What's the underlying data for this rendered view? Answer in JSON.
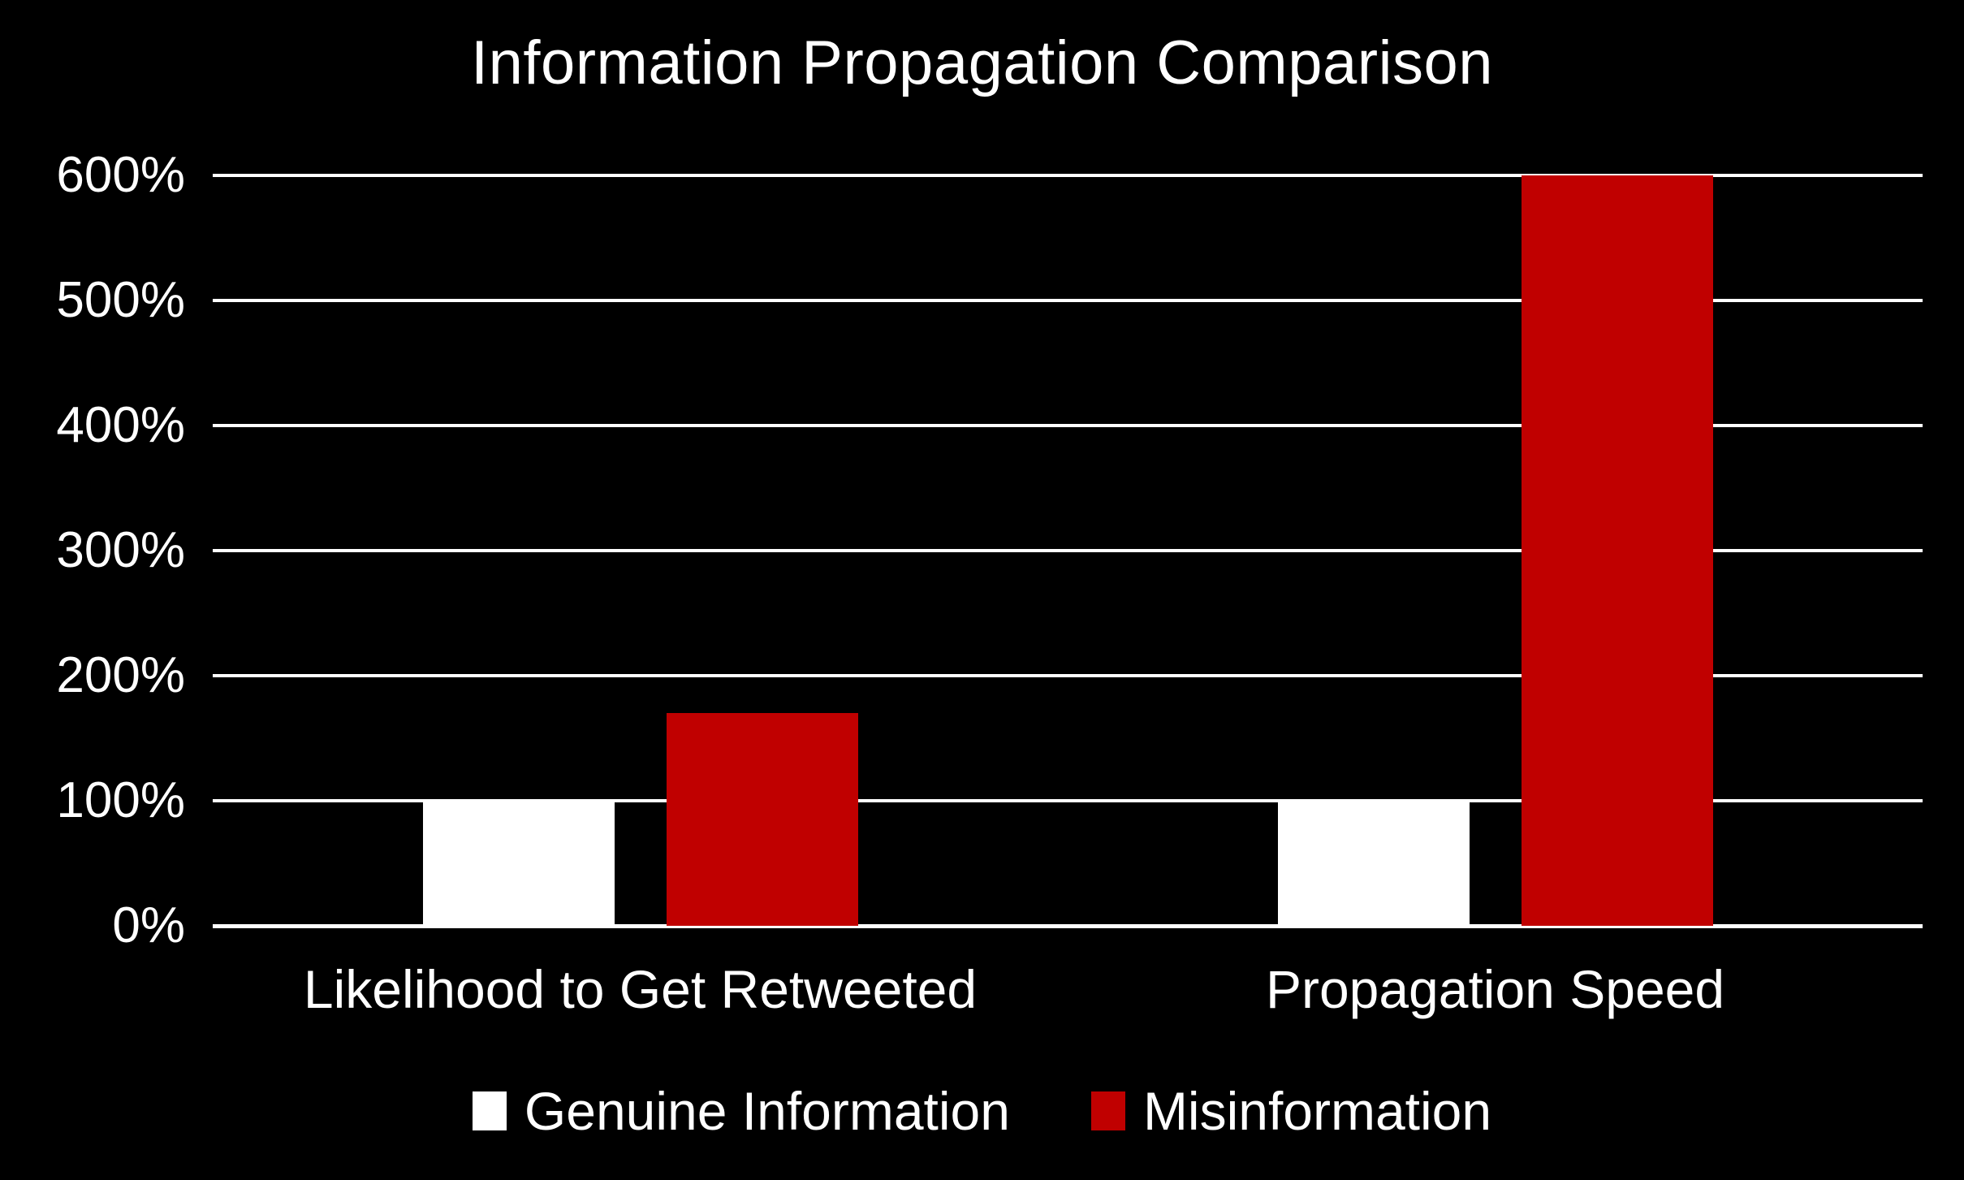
{
  "chart_data": {
    "type": "bar",
    "title": "Information Propagation Comparison",
    "xlabel": "",
    "ylabel": "",
    "categories": [
      "Likelihood to Get Retweeted",
      "Propagation Speed"
    ],
    "series": [
      {
        "name": "Genuine Information",
        "values": [
          100,
          100
        ],
        "color": "#FFFFFF"
      },
      {
        "name": "Misinformation",
        "values": [
          170,
          600
        ],
        "color": "#C00000"
      }
    ],
    "ylim": [
      0,
      600
    ],
    "y_tick_values": [
      0,
      100,
      200,
      300,
      400,
      500,
      600
    ],
    "y_tick_labels": [
      "0%",
      "100%",
      "200%",
      "300%",
      "400%",
      "500%",
      "600%"
    ],
    "value_unit": "%",
    "grid": "horizontal",
    "legend_position": "bottom",
    "background_color": "#000000",
    "foreground_color": "#FFFFFF"
  },
  "legend": {
    "entries": [
      {
        "label": "Genuine Information",
        "swatch": "genuine"
      },
      {
        "label": "Misinformation",
        "swatch": "misinfo"
      }
    ]
  }
}
